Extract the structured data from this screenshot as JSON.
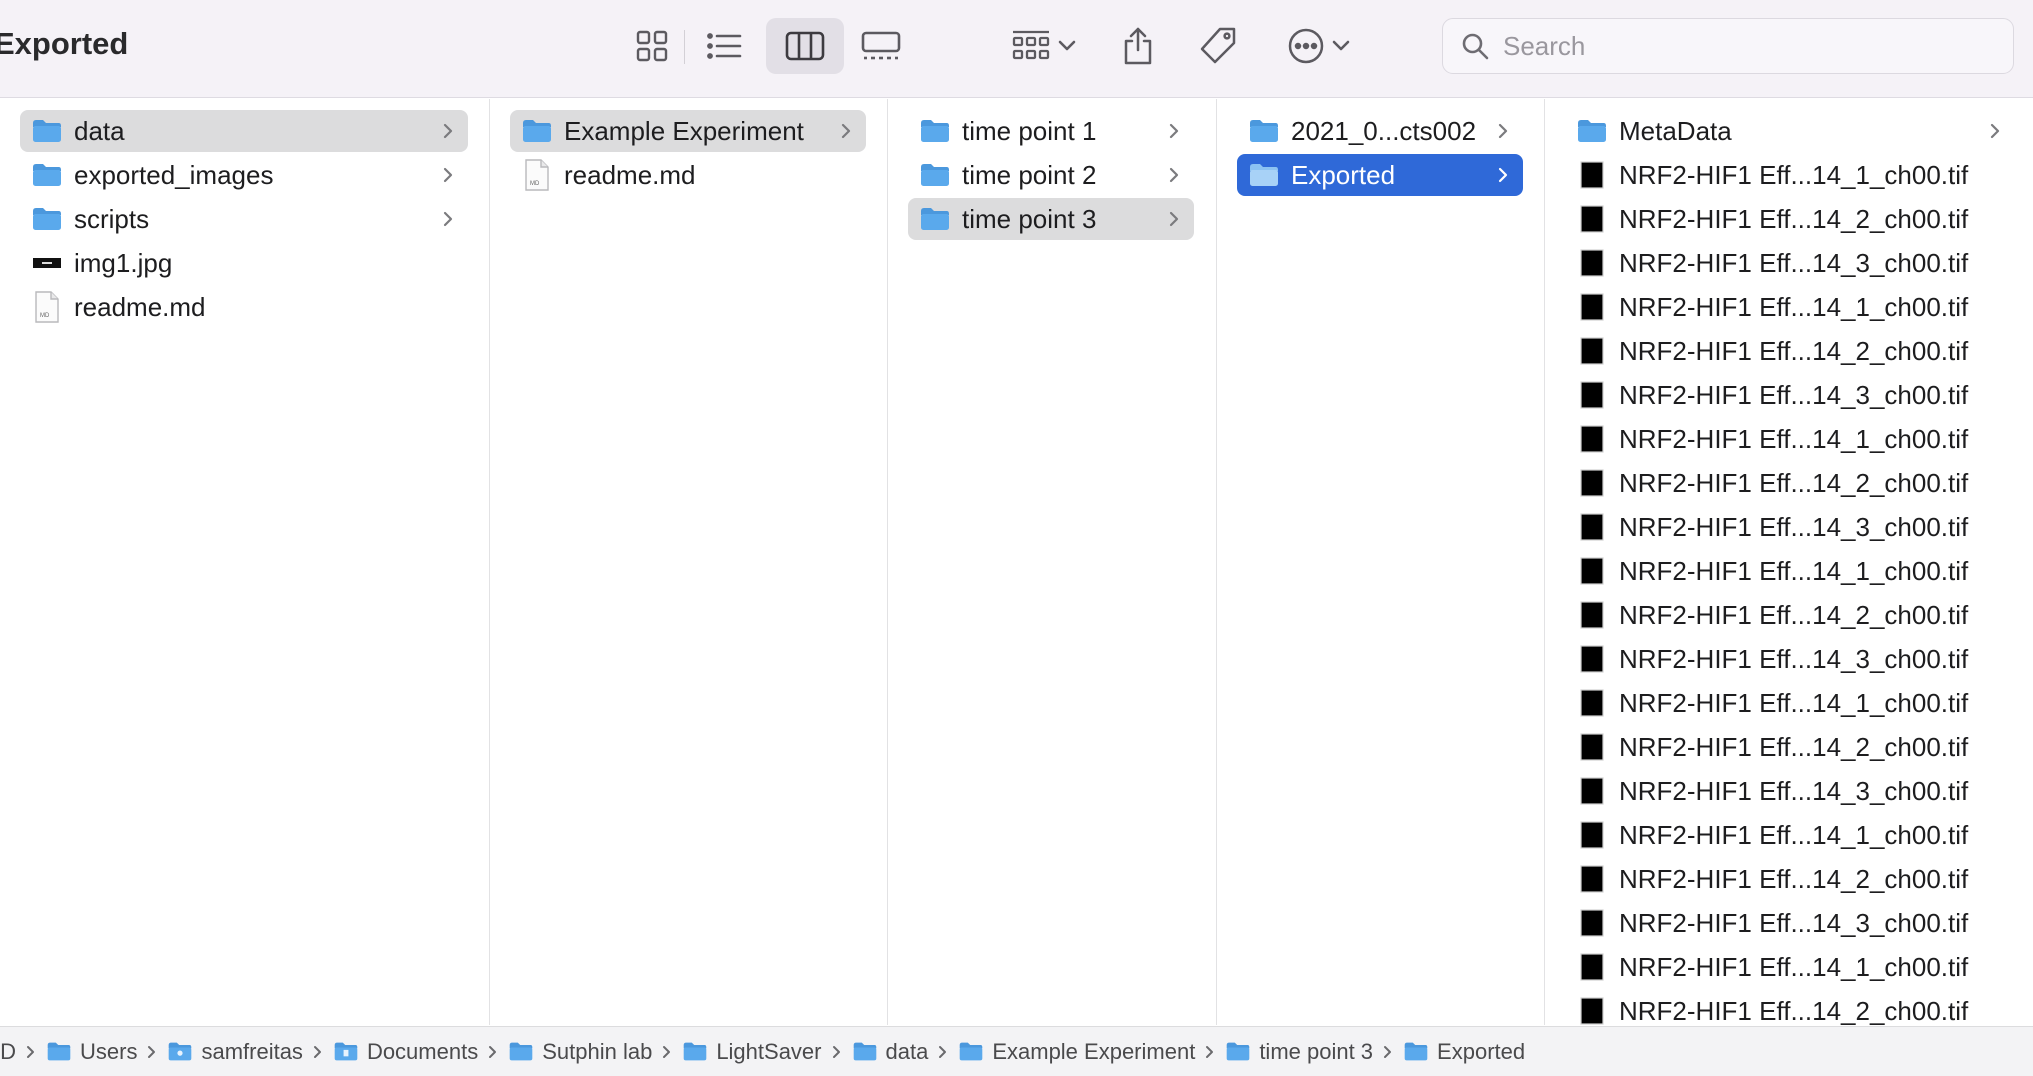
{
  "window": {
    "title": "Exported"
  },
  "toolbar": {
    "icons": [
      "grid-view-icon",
      "list-view-icon",
      "column-view-icon",
      "gallery-view-icon",
      "group-icon",
      "chevron-down-icon",
      "share-icon",
      "tag-icon",
      "more-icon"
    ],
    "active_view": "column-view",
    "search": {
      "placeholder": "Search",
      "value": ""
    }
  },
  "colors": {
    "folder": "#5aa9ec",
    "selection_blue": "#2f69d8",
    "selection_grey": "#dcdcdd",
    "toolbar_bg": "#f5f2f7"
  },
  "columns": [
    {
      "items": [
        {
          "label": "data",
          "type": "folder",
          "has_children": true,
          "selected": "grey"
        },
        {
          "label": "exported_images",
          "type": "folder",
          "has_children": true
        },
        {
          "label": "scripts",
          "type": "folder",
          "has_children": true
        },
        {
          "label": "img1.jpg",
          "type": "image"
        },
        {
          "label": "readme.md",
          "type": "markdown"
        }
      ]
    },
    {
      "items": [
        {
          "label": "Example Experiment",
          "type": "folder",
          "has_children": true,
          "selected": "grey"
        },
        {
          "label": "readme.md",
          "type": "markdown"
        }
      ]
    },
    {
      "items": [
        {
          "label": "time point 1",
          "type": "folder",
          "has_children": true
        },
        {
          "label": "time point 2",
          "type": "folder",
          "has_children": true
        },
        {
          "label": "time point 3",
          "type": "folder",
          "has_children": true,
          "selected": "grey"
        }
      ]
    },
    {
      "items": [
        {
          "label": "2021_0...cts002",
          "type": "folder",
          "has_children": true
        },
        {
          "label": "Exported",
          "type": "folder",
          "has_children": true,
          "selected": "blue"
        }
      ]
    },
    {
      "items": [
        {
          "label": "MetaData",
          "type": "folder",
          "has_children": true
        },
        {
          "label": "NRF2-HIF1 Eff...14_1_ch00.tif",
          "type": "tif"
        },
        {
          "label": "NRF2-HIF1 Eff...14_2_ch00.tif",
          "type": "tif"
        },
        {
          "label": "NRF2-HIF1 Eff...14_3_ch00.tif",
          "type": "tif"
        },
        {
          "label": "NRF2-HIF1 Eff...14_1_ch00.tif",
          "type": "tif"
        },
        {
          "label": "NRF2-HIF1 Eff...14_2_ch00.tif",
          "type": "tif"
        },
        {
          "label": "NRF2-HIF1 Eff...14_3_ch00.tif",
          "type": "tif"
        },
        {
          "label": "NRF2-HIF1 Eff...14_1_ch00.tif",
          "type": "tif"
        },
        {
          "label": "NRF2-HIF1 Eff...14_2_ch00.tif",
          "type": "tif"
        },
        {
          "label": "NRF2-HIF1 Eff...14_3_ch00.tif",
          "type": "tif"
        },
        {
          "label": "NRF2-HIF1 Eff...14_1_ch00.tif",
          "type": "tif"
        },
        {
          "label": "NRF2-HIF1 Eff...14_2_ch00.tif",
          "type": "tif"
        },
        {
          "label": "NRF2-HIF1 Eff...14_3_ch00.tif",
          "type": "tif"
        },
        {
          "label": "NRF2-HIF1 Eff...14_1_ch00.tif",
          "type": "tif"
        },
        {
          "label": "NRF2-HIF1 Eff...14_2_ch00.tif",
          "type": "tif"
        },
        {
          "label": "NRF2-HIF1 Eff...14_3_ch00.tif",
          "type": "tif"
        },
        {
          "label": "NRF2-HIF1 Eff...14_1_ch00.tif",
          "type": "tif"
        },
        {
          "label": "NRF2-HIF1 Eff...14_2_ch00.tif",
          "type": "tif"
        },
        {
          "label": "NRF2-HIF1 Eff...14_3_ch00.tif",
          "type": "tif"
        },
        {
          "label": "NRF2-HIF1 Eff...14_1_ch00.tif",
          "type": "tif"
        },
        {
          "label": "NRF2-HIF1 Eff...14_2_ch00.tif",
          "type": "tif"
        }
      ]
    }
  ],
  "pathbar": [
    {
      "label": "ID",
      "icon": "none"
    },
    {
      "label": "Users",
      "icon": "folder"
    },
    {
      "label": "samfreitas",
      "icon": "home-folder"
    },
    {
      "label": "Documents",
      "icon": "documents-folder"
    },
    {
      "label": "Sutphin lab",
      "icon": "folder"
    },
    {
      "label": "LightSaver",
      "icon": "folder"
    },
    {
      "label": "data",
      "icon": "folder"
    },
    {
      "label": "Example Experiment",
      "icon": "folder"
    },
    {
      "label": "time point 3",
      "icon": "folder"
    },
    {
      "label": "Exported",
      "icon": "folder"
    }
  ]
}
